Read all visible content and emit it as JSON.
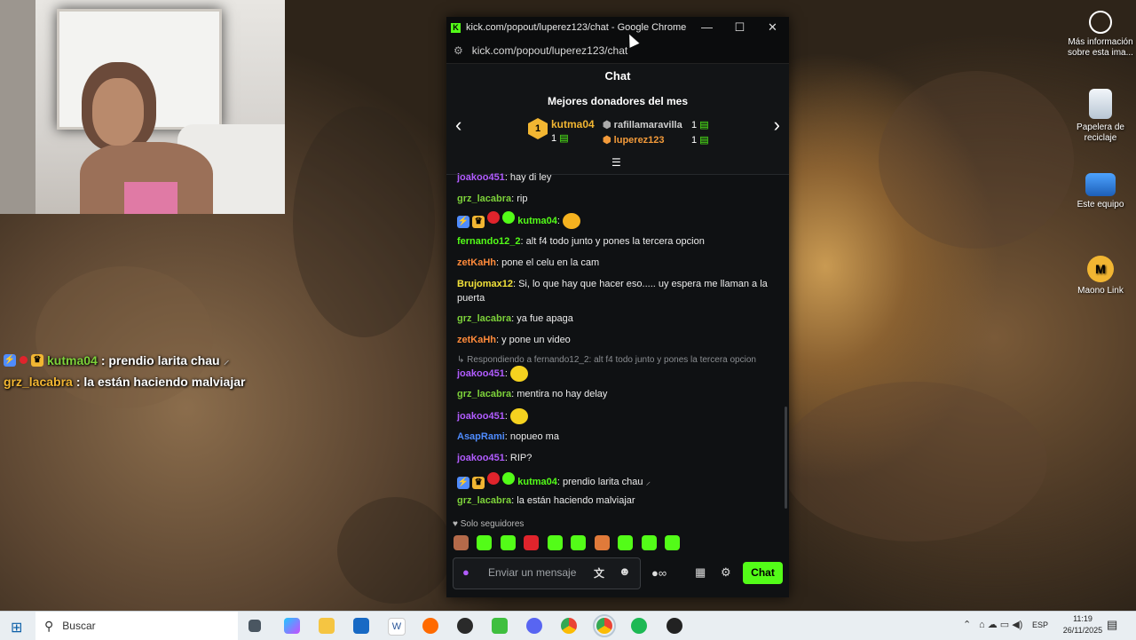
{
  "browser": {
    "title": "kick.com/popout/luperez123/chat - Google Chrome",
    "url": "kick.com/popout/luperez123/chat"
  },
  "chat": {
    "header": "Chat",
    "donors": {
      "title": "Mejores donadores del mes",
      "first": {
        "rank": "1",
        "name": "kutma04",
        "count": "1"
      },
      "second": {
        "name": "rafillamaravilla",
        "count": "1"
      },
      "third": {
        "name": "luperez123",
        "count": "1"
      }
    },
    "messages": [
      {
        "user": "joakoo451",
        "text": ": hay di ley",
        "color": "#b15cff"
      },
      {
        "user": "grz_lacabra",
        "text": ": rip",
        "color": "#7dd23a"
      },
      {
        "user": "kutma04",
        "text": ":",
        "color": "#53fc18"
      },
      {
        "user": "fernando12_2",
        "text": ": alt f4 todo junto y pones la tercera opcion",
        "color": "#53fc18"
      },
      {
        "user": "zetKaHh",
        "text": ": pone el celu en la cam",
        "color": "#ff8a3a"
      },
      {
        "user": "Brujomax12",
        "text": ": Si, lo que hay que hacer eso..... uy espera me llaman a la puerta",
        "color": "#f2e23a"
      },
      {
        "user": "grz_lacabra",
        "text": ": ya fue apaga",
        "color": "#7dd23a"
      },
      {
        "user": "zetKaHh",
        "text": ": y pone un video",
        "color": "#ff8a3a"
      },
      {
        "user": "joakoo451",
        "text": ":",
        "color": "#b15cff"
      },
      {
        "user": "grz_lacabra",
        "text": ": mentira no hay delay",
        "color": "#7dd23a"
      },
      {
        "user": "joakoo451",
        "text": ":",
        "color": "#b15cff"
      },
      {
        "user": "AsapRami",
        "text": ": nopueo ma",
        "color": "#4f8cff"
      },
      {
        "user": "joakoo451",
        "text": ": RIP?",
        "color": "#b15cff"
      },
      {
        "user": "kutma04",
        "text": ": prendio larita chau",
        "color": "#53fc18"
      },
      {
        "user": "grz_lacabra",
        "text": ": la están haciendo malviajar",
        "color": "#7dd23a"
      }
    ],
    "reply_text": "Respondiendo a fernando12_2: alt f4 todo junto y pones la tercera opcion",
    "followers_only": "Solo seguidores",
    "input_placeholder": "Enviar un mensaje",
    "send_label": "Chat"
  },
  "overlay": {
    "line1_user": "kutma04",
    "line1_text": ": prendio larita chau",
    "line2_user": "grz_lacabra",
    "line2_text": ": la están haciendo malviajar"
  },
  "desktop": {
    "info": "Más información sobre esta ima...",
    "recycle": "Papelera de reciclaje",
    "thispc": "Este equipo",
    "maono": "Maono Link"
  },
  "taskbar": {
    "search": "Buscar",
    "lang": "ESP",
    "time": "11:19",
    "date": "26/11/2025"
  },
  "colors": {
    "kick_green": "#53fc18",
    "donor_gold": "#f2b632"
  }
}
